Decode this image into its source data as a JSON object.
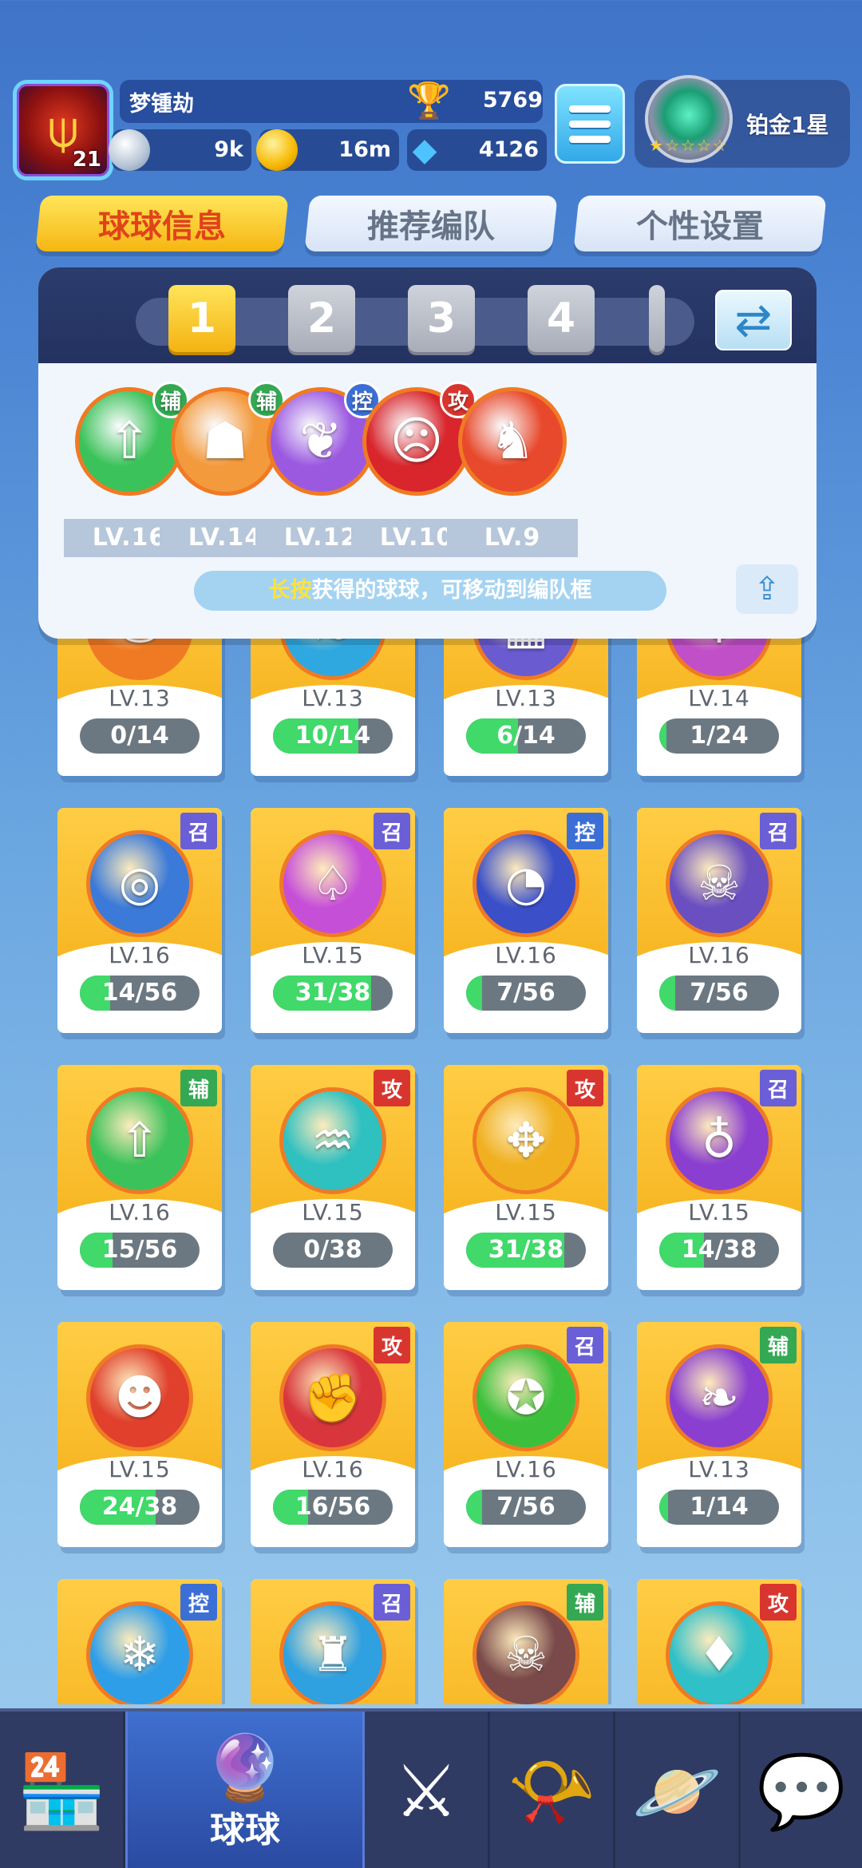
{
  "player": {
    "name": "梦锺劫",
    "level": "21",
    "trophies": "5769",
    "silver": "9k",
    "gold": "16m",
    "gems": "4126"
  },
  "rank": {
    "name": "铂金1星",
    "stars": "★☆☆☆☆"
  },
  "tabs": [
    "球球信息",
    "推荐编队",
    "个性设置"
  ],
  "team": {
    "slots": [
      "1",
      "2",
      "3",
      "4"
    ],
    "balls": [
      {
        "role": "辅",
        "level": "LV.16",
        "icon": "arrow-up-icon",
        "glyph": "⇧",
        "color": "#3cc25a",
        "role_color": "#33b05a"
      },
      {
        "role": "辅",
        "level": "LV.14",
        "icon": "people-icon",
        "glyph": "☗",
        "color": "#f39a3d",
        "role_color": "#33b05a"
      },
      {
        "role": "控",
        "level": "LV.12",
        "icon": "butterfly-icon",
        "glyph": "❦",
        "color": "#9b59e0",
        "role_color": "#3a7fd8"
      },
      {
        "role": "攻",
        "level": "LV.10",
        "icon": "opera-mask-icon",
        "glyph": "☹",
        "color": "#d8262c",
        "role_color": "#d8332c"
      },
      {
        "role": "",
        "level": "LV.9",
        "icon": "dragon-icon",
        "glyph": "♞",
        "color": "#e8492c",
        "role_color": "#d8332c"
      }
    ],
    "hint_highlight": "长按",
    "hint_text": "获得的球球，可移动到编队框"
  },
  "collection": [
    {
      "role": "",
      "level": "LV.13",
      "progress": "0/14",
      "fraction": 0.0,
      "icon": "phoenix-icon",
      "glyph": "♨",
      "color": "#f07a24"
    },
    {
      "role": "",
      "level": "LV.13",
      "progress": "10/14",
      "fraction": 0.71,
      "icon": "wave-icon",
      "glyph": "≋",
      "color": "#2fa8e0"
    },
    {
      "role": "",
      "level": "LV.13",
      "progress": "6/14",
      "fraction": 0.43,
      "icon": "wall-icon",
      "glyph": "▦",
      "color": "#6a5bd0"
    },
    {
      "role": "",
      "level": "LV.14",
      "progress": "1/24",
      "fraction": 0.04,
      "icon": "flame-icon",
      "glyph": "♆",
      "color": "#c04fc8"
    },
    {
      "role": "召",
      "level": "LV.16",
      "progress": "14/56",
      "fraction": 0.25,
      "icon": "vortex-icon",
      "glyph": "◎",
      "color": "#3b7ad8"
    },
    {
      "role": "召",
      "level": "LV.15",
      "progress": "31/38",
      "fraction": 0.82,
      "icon": "mushroom-icon",
      "glyph": "♤",
      "color": "#c64fd8"
    },
    {
      "role": "控",
      "level": "LV.16",
      "progress": "7/56",
      "fraction": 0.13,
      "icon": "clock-icon",
      "glyph": "◔",
      "color": "#3a4fc8"
    },
    {
      "role": "召",
      "level": "LV.16",
      "progress": "7/56",
      "fraction": 0.13,
      "icon": "ghost-icon",
      "glyph": "☠",
      "color": "#6a4fc0"
    },
    {
      "role": "辅",
      "level": "LV.16",
      "progress": "15/56",
      "fraction": 0.27,
      "icon": "arrow-up-icon",
      "glyph": "⇧",
      "color": "#3cc25a"
    },
    {
      "role": "攻",
      "level": "LV.15",
      "progress": "0/38",
      "fraction": 0.0,
      "icon": "tornado-icon",
      "glyph": "♒",
      "color": "#2fc0c0"
    },
    {
      "role": "攻",
      "level": "LV.15",
      "progress": "31/38",
      "fraction": 0.82,
      "icon": "shuriken-icon",
      "glyph": "✥",
      "color": "#f0b020"
    },
    {
      "role": "召",
      "level": "LV.15",
      "progress": "14/38",
      "fraction": 0.37,
      "icon": "planet-icon",
      "glyph": "♁",
      "color": "#8a3fd0"
    },
    {
      "role": "",
      "level": "LV.15",
      "progress": "24/38",
      "fraction": 0.63,
      "icon": "gorilla-icon",
      "glyph": "☻",
      "color": "#e0402c"
    },
    {
      "role": "攻",
      "level": "LV.16",
      "progress": "16/56",
      "fraction": 0.29,
      "icon": "fist-icon",
      "glyph": "✊",
      "color": "#d8363c"
    },
    {
      "role": "召",
      "level": "LV.16",
      "progress": "7/56",
      "fraction": 0.13,
      "icon": "star-icon",
      "glyph": "✪",
      "color": "#3cc03c"
    },
    {
      "role": "辅",
      "level": "LV.13",
      "progress": "1/14",
      "fraction": 0.07,
      "icon": "leaf-icon",
      "glyph": "❧",
      "color": "#8a3fd0"
    },
    {
      "role": "控",
      "level": "",
      "progress": "",
      "fraction": 0,
      "icon": "snowflake-icon",
      "glyph": "❄",
      "color": "#2f9ee8"
    },
    {
      "role": "召",
      "level": "",
      "progress": "",
      "fraction": 0,
      "icon": "castle-icon",
      "glyph": "♜",
      "color": "#2fa0e0"
    },
    {
      "role": "辅",
      "level": "",
      "progress": "",
      "fraction": 0,
      "icon": "skull-icon",
      "glyph": "☠",
      "color": "#7a4a4a"
    },
    {
      "role": "攻",
      "level": "",
      "progress": "",
      "fraction": 0,
      "icon": "crystal-icon",
      "glyph": "♦",
      "color": "#2fc0c8"
    }
  ],
  "role_colors": {
    "辅": "#34a853",
    "控": "#3b6fd6",
    "攻": "#d9352f",
    "召": "#6a5fd6"
  },
  "nav": {
    "active_label": "球球",
    "items": [
      "shop-icon",
      "ball-icon",
      "swords-icon",
      "whistle-icon",
      "planet-icon",
      "chat-icon"
    ]
  }
}
